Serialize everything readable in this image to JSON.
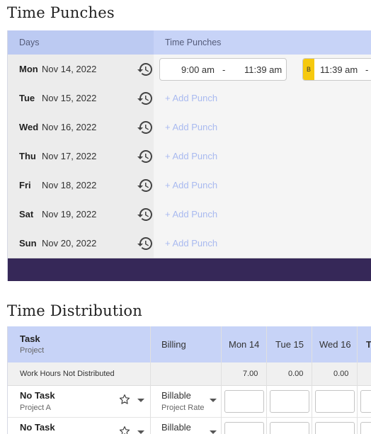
{
  "time_punches": {
    "title": "Time Punches",
    "header": {
      "days": "Days",
      "time_punches": "Time Punches"
    },
    "add_punch_label": "+ Add Punch",
    "rows": [
      {
        "day": "Mon",
        "date": "Nov 14, 2022",
        "punches": [
          {
            "in": "9:00 am",
            "sep": "-",
            "out": "11:39 am"
          },
          {
            "badge": "B",
            "in": "11:39 am",
            "sep": "-"
          }
        ]
      },
      {
        "day": "Tue",
        "date": "Nov 15, 2022"
      },
      {
        "day": "Wed",
        "date": "Nov 16, 2022"
      },
      {
        "day": "Thu",
        "date": "Nov 17, 2022"
      },
      {
        "day": "Fri",
        "date": "Nov 18, 2022"
      },
      {
        "day": "Sat",
        "date": "Nov 19, 2022"
      },
      {
        "day": "Sun",
        "date": "Nov 20, 2022"
      }
    ]
  },
  "time_distribution": {
    "title": "Time Distribution",
    "header": {
      "task": "Task",
      "project": "Project",
      "billing": "Billing",
      "days": [
        "Mon 14",
        "Tue 15",
        "Wed 16",
        "T"
      ]
    },
    "work_hours_row": {
      "label": "Work Hours Not Distributed",
      "values": [
        "7.00",
        "0.00",
        "0.00"
      ]
    },
    "rows": [
      {
        "task": "No Task",
        "project": "Project A",
        "billing": "Billable",
        "rate": "Project Rate"
      },
      {
        "task": "No Task",
        "project": "",
        "billing": "Billable",
        "rate": ""
      }
    ]
  },
  "colors": {
    "header_bg": "#c7d3f7",
    "footer_bar": "#362858",
    "badge": "#f6c90e",
    "add_punch": "#a9baf0"
  }
}
